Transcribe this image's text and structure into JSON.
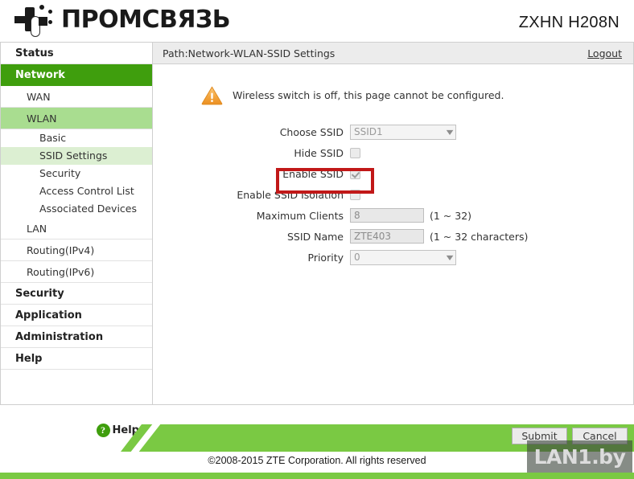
{
  "header": {
    "brand_text": "ПРОМСВЯЗЬ",
    "brand_logo_icon": "promsvyaz-logo-icon",
    "model": "ZXHN H208N"
  },
  "sidebar": {
    "items": [
      {
        "label": "Status",
        "level": "top",
        "state": "normal"
      },
      {
        "label": "Network",
        "level": "top",
        "state": "active"
      },
      {
        "label": "WAN",
        "level": "sub",
        "state": "normal"
      },
      {
        "label": "WLAN",
        "level": "sub",
        "state": "branch"
      },
      {
        "label": "Basic",
        "level": "sub2",
        "state": "normal"
      },
      {
        "label": "SSID Settings",
        "level": "sub2",
        "state": "selected"
      },
      {
        "label": "Security",
        "level": "sub2",
        "state": "normal"
      },
      {
        "label": "Access Control List",
        "level": "sub2",
        "state": "normal"
      },
      {
        "label": "Associated Devices",
        "level": "sub2",
        "state": "normal"
      },
      {
        "label": "LAN",
        "level": "sub",
        "state": "normal"
      },
      {
        "label": "Routing(IPv4)",
        "level": "sub",
        "state": "normal"
      },
      {
        "label": "Routing(IPv6)",
        "level": "sub",
        "state": "normal"
      },
      {
        "label": "Security",
        "level": "top",
        "state": "normal"
      },
      {
        "label": "Application",
        "level": "top",
        "state": "normal"
      },
      {
        "label": "Administration",
        "level": "top",
        "state": "normal"
      },
      {
        "label": "Help",
        "level": "top",
        "state": "normal"
      }
    ],
    "help": {
      "icon": "question-mark-icon",
      "label": "Help"
    }
  },
  "main": {
    "path": "Path:Network-WLAN-SSID Settings",
    "logout_label": "Logout",
    "warning": {
      "icon": "warning-triangle-icon",
      "text": "Wireless switch is off, this page cannot be configured."
    },
    "fields": {
      "choose_ssid": {
        "label": "Choose SSID",
        "value": "SSID1",
        "caret_icon": "chevron-down-icon"
      },
      "hide_ssid": {
        "label": "Hide SSID",
        "checked": false
      },
      "enable_ssid": {
        "label": "Enable SSID",
        "checked": true,
        "highlighted": true,
        "highlight_color": "#c11818"
      },
      "enable_ssid_isolation": {
        "label": "Enable SSID Isolation",
        "checked": false
      },
      "maximum_clients": {
        "label": "Maximum Clients",
        "value": "8",
        "hint": "(1 ~ 32)"
      },
      "ssid_name": {
        "label": "SSID Name",
        "value": "ZTE403",
        "hint": "(1 ~ 32 characters)"
      },
      "priority": {
        "label": "Priority",
        "value": "0",
        "caret_icon": "chevron-down-icon"
      }
    }
  },
  "footer": {
    "submit_label": "Submit",
    "cancel_label": "Cancel",
    "copyright": "©2008-2015 ZTE Corporation. All rights reserved",
    "watermark": "LAN1.by"
  },
  "colors": {
    "brand_green": "#7ac943",
    "nav_active_green": "#3f9e0d",
    "nav_branch_green": "#a9dd90",
    "nav_selected_green": "#dcefd2",
    "highlight_red": "#c11818",
    "warning_orange": "#f2a33c"
  }
}
